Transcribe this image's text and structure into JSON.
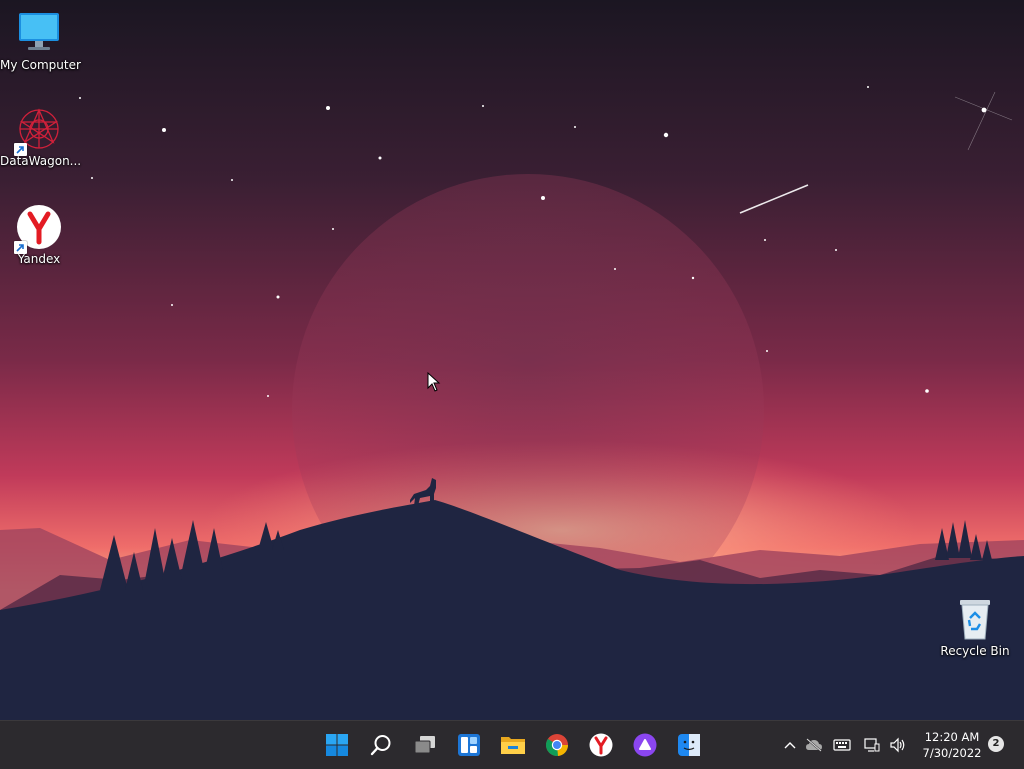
{
  "desktop": {
    "icons": [
      {
        "label": "My Computer",
        "icon": "monitor-icon"
      },
      {
        "label": "DataWagon...",
        "icon": "datawagon-app-icon"
      },
      {
        "label": "Yandex",
        "icon": "yandex-browser-icon"
      }
    ],
    "recycle_bin": {
      "label": "Recycle Bin",
      "icon": "recycle-bin-icon"
    }
  },
  "taskbar": {
    "pinned": [
      {
        "name": "start-button",
        "icon": "windows-logo-icon"
      },
      {
        "name": "search-button",
        "icon": "search-icon"
      },
      {
        "name": "task-view-button",
        "icon": "task-view-icon"
      },
      {
        "name": "widgets-button",
        "icon": "widgets-icon"
      },
      {
        "name": "file-explorer-button",
        "icon": "folder-icon"
      },
      {
        "name": "chrome-button",
        "icon": "chrome-icon"
      },
      {
        "name": "yandex-button",
        "icon": "yandex-icon"
      },
      {
        "name": "alice-button",
        "icon": "alice-icon"
      },
      {
        "name": "finder-button",
        "icon": "finder-icon"
      }
    ],
    "tray": {
      "icons": [
        "chevron-up-icon",
        "cloud-offline-icon",
        "keyboard-icon",
        "network-icon",
        "volume-icon"
      ],
      "time": "12:20 AM",
      "date": "7/30/2022",
      "notification_count": "2"
    }
  },
  "colors": {
    "taskbar_bg": "#2c2a2e",
    "sky_top": "#1d1726",
    "sky_glow": "#f28a6e",
    "mountain": "#1f2440"
  }
}
